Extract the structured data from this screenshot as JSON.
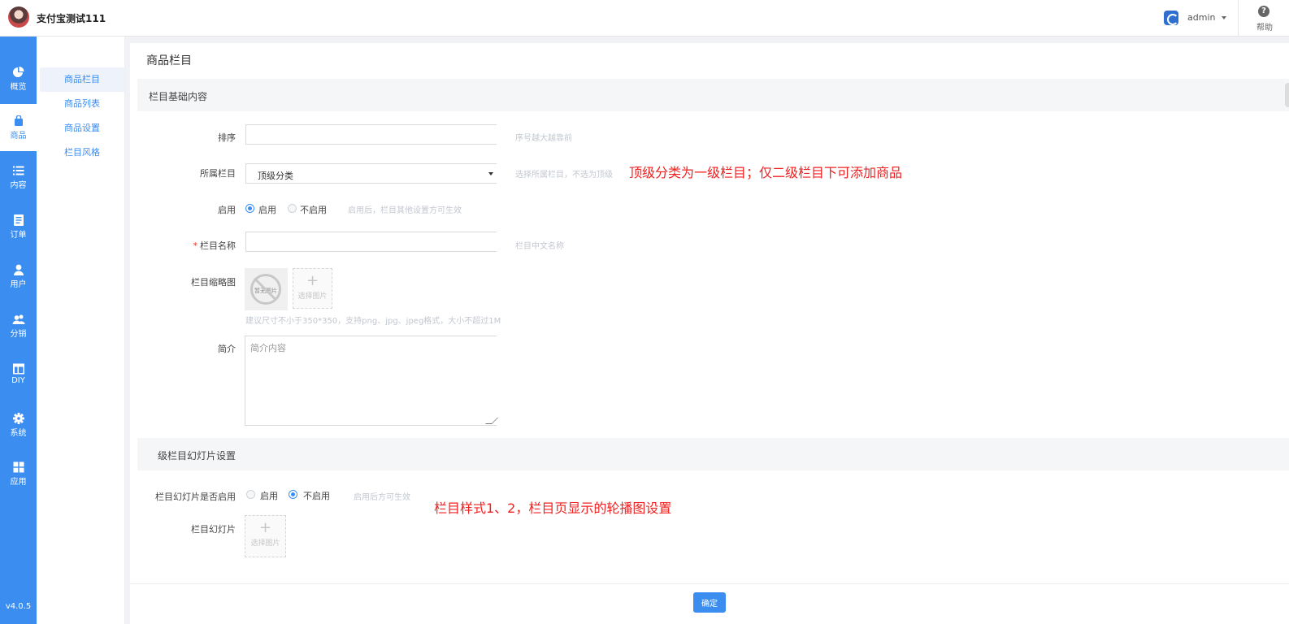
{
  "header": {
    "store_name": "支付宝测试111",
    "user_name": "admin",
    "help_label": "帮助"
  },
  "sidebar": {
    "items": [
      {
        "label": "概览",
        "icon": "pie-chart-icon"
      },
      {
        "label": "商品",
        "icon": "bag-icon"
      },
      {
        "label": "内容",
        "icon": "list-icon"
      },
      {
        "label": "订单",
        "icon": "order-icon"
      },
      {
        "label": "用户",
        "icon": "user-icon"
      },
      {
        "label": "分销",
        "icon": "group-icon"
      },
      {
        "label": "DIY",
        "icon": "layout-icon"
      },
      {
        "label": "系统",
        "icon": "gear-icon"
      },
      {
        "label": "应用",
        "icon": "apps-icon"
      }
    ],
    "version": "v4.0.5"
  },
  "submenu": {
    "items": [
      "商品栏目",
      "商品列表",
      "商品设置",
      "栏目风格"
    ]
  },
  "page": {
    "title": "商品栏目"
  },
  "section1": {
    "title": "栏目基础内容"
  },
  "form": {
    "sort_label": "排序",
    "sort_value": "",
    "sort_hint": "序号越大越靠前",
    "parent_label": "所属栏目",
    "parent_value": "顶级分类",
    "parent_hint": "选择所属栏目，不选为顶级",
    "enable_label": "启用",
    "enable_on": "启用",
    "enable_off": "不启用",
    "enable_hint": "启用后，栏目其他设置方可生效",
    "name_label": "栏目名称",
    "name_value": "",
    "name_hint": "栏目中文名称",
    "thumb_label": "栏目缩略图",
    "thumb_placeholder": "暂无图片",
    "upload_text": "选择图片",
    "thumb_hint": "建议尺寸不小于350*350，支持png、jpg、jpeg格式，大小不超过1M",
    "intro_label": "简介",
    "intro_placeholder": "简介内容"
  },
  "section2": {
    "title": "级栏目幻灯片设置"
  },
  "slide_form": {
    "enable_label": "栏目幻灯片是否启用",
    "on": "启用",
    "off": "不启用",
    "hint": "启用后方可生效",
    "slide_label": "栏目幻灯片",
    "upload_text": "选择图片"
  },
  "annotations": {
    "a1": "顶级分类为一级栏目；仅二级栏目下可添加商品",
    "a2": "栏目样式1、2，栏目页显示的轮播图设置"
  },
  "confirm_label": "确定"
}
